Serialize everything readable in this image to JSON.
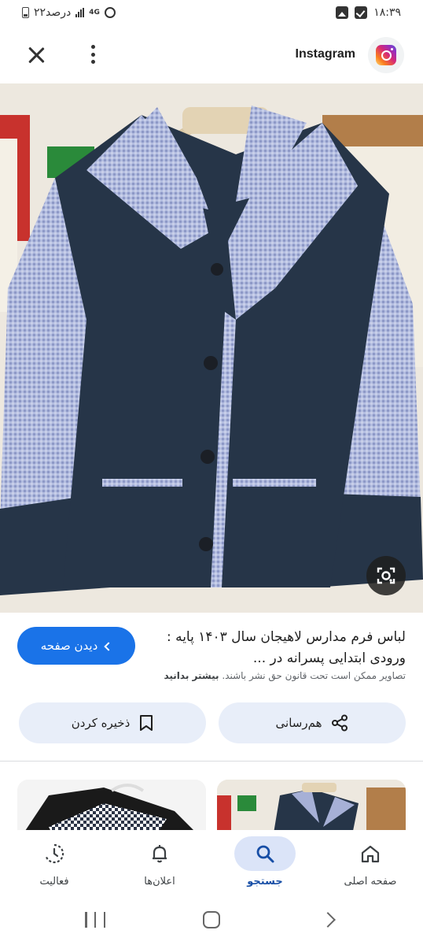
{
  "status_bar": {
    "time": "۱۸:۳۹",
    "battery": "۲۲درصد",
    "network": "4G"
  },
  "header": {
    "site_name": "Instagram",
    "logo_icon": "instagram-logo",
    "close_icon": "close-icon",
    "more_icon": "more-vert-icon"
  },
  "result": {
    "title": "لباس فرم مدارس لاهیجان سال ۱۴۰۳ پایه : ورودی ابتدایی پسرانه در ...",
    "copyright": "تصاویر ممکن است تحت قانون حق نشر باشند.",
    "learn_more": "بیشتر بدانید",
    "visit_label": "دیدن صفحه",
    "share_label": "هم‌رسانی",
    "save_label": "ذخیره کردن"
  },
  "bottom_nav": {
    "items": [
      {
        "label": "صفحه اصلی",
        "icon": "home-icon"
      },
      {
        "label": "جستجو",
        "icon": "search-icon"
      },
      {
        "label": "اعلان‌ها",
        "icon": "bell-icon"
      },
      {
        "label": "فعالیت",
        "icon": "activity-icon"
      }
    ],
    "active": "جستجو"
  },
  "colors": {
    "accent": "#1a73e8",
    "pill_bg": "#e8eef9",
    "nav_active_bg": "#dbe4f8",
    "jacket_navy": "#263548",
    "jacket_check": "#a6b0d6"
  }
}
